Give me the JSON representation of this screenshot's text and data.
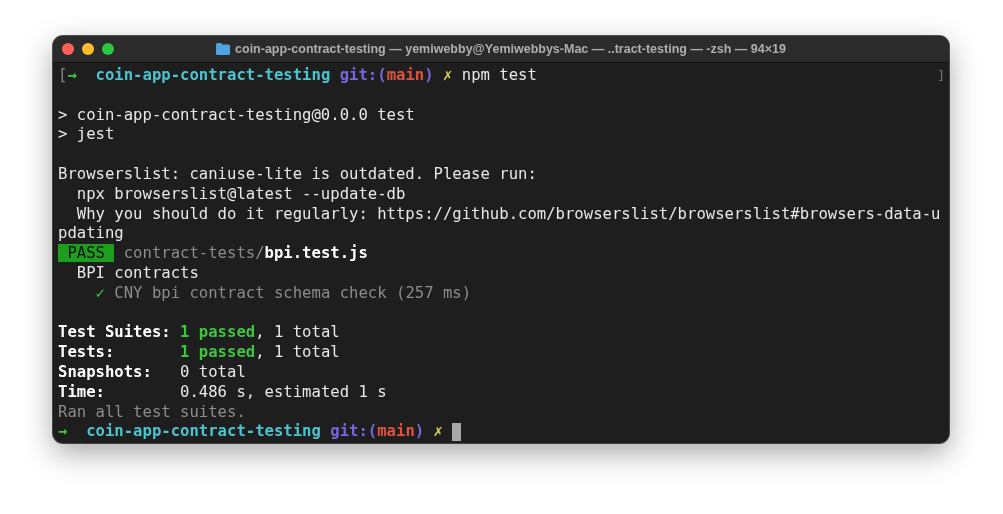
{
  "window": {
    "title": "coin-app-contract-testing — yemiwebby@Yemiwebbys-Mac — ..tract-testing — -zsh — 94×19"
  },
  "blocks": [
    [
      {
        "segments": [
          {
            "text": "[",
            "kind": "mark"
          },
          {
            "text": "→  ",
            "kind": "arrow"
          },
          {
            "text": "coin-app-contract-testing ",
            "kind": "dir"
          },
          {
            "text": "git:(",
            "kind": "git"
          },
          {
            "text": "main",
            "kind": "branch"
          },
          {
            "text": ") ",
            "kind": "git"
          },
          {
            "text": "✗ ",
            "kind": "dirty"
          },
          {
            "text": "npm test",
            "kind": "plain"
          }
        ],
        "right_mark": "]"
      }
    ],
    [
      {
        "segments": [
          {
            "text": "> coin-app-contract-testing@0.0.0 test",
            "kind": "plain"
          }
        ]
      },
      {
        "segments": [
          {
            "text": "> jest",
            "kind": "plain"
          }
        ]
      }
    ],
    [
      {
        "segments": [
          {
            "text": "Browserslist: caniuse-lite is outdated. Please run:",
            "kind": "plain"
          }
        ]
      },
      {
        "segments": [
          {
            "text": "  npx browserslist@latest --update-db",
            "kind": "plain"
          }
        ]
      },
      {
        "segments": [
          {
            "text": "  Why you should do it regularly: https://github.com/browserslist/browserslist#browsers-data-u",
            "kind": "plain"
          }
        ]
      },
      {
        "segments": [
          {
            "text": "pdating",
            "kind": "plain"
          }
        ]
      },
      {
        "segments": [
          {
            "text": " PASS ",
            "kind": "badge"
          },
          {
            "text": " contract-tests/",
            "kind": "dim"
          },
          {
            "text": "bpi.test.js",
            "kind": "bold"
          }
        ]
      },
      {
        "segments": [
          {
            "text": "  BPI contracts",
            "kind": "plain"
          }
        ]
      },
      {
        "segments": [
          {
            "text": "    ✓",
            "kind": "check"
          },
          {
            "text": " CNY bpi contract schema check (257 ms)",
            "kind": "dim"
          }
        ]
      }
    ],
    [
      {
        "segments": [
          {
            "text": "Test Suites: ",
            "kind": "bold"
          },
          {
            "text": "1 passed",
            "kind": "pass"
          },
          {
            "text": ", 1 total",
            "kind": "plain"
          }
        ]
      },
      {
        "segments": [
          {
            "text": "Tests:       ",
            "kind": "bold"
          },
          {
            "text": "1 passed",
            "kind": "pass"
          },
          {
            "text": ", 1 total",
            "kind": "plain"
          }
        ]
      },
      {
        "segments": [
          {
            "text": "Snapshots:   ",
            "kind": "bold"
          },
          {
            "text": "0 total",
            "kind": "plain"
          }
        ]
      },
      {
        "segments": [
          {
            "text": "Time:        ",
            "kind": "bold"
          },
          {
            "text": "0.486 s, estimated 1 s",
            "kind": "plain"
          }
        ]
      },
      {
        "segments": [
          {
            "text": "Ran all test suites.",
            "kind": "dim"
          }
        ]
      },
      {
        "segments": [
          {
            "text": "→  ",
            "kind": "arrow"
          },
          {
            "text": "coin-app-contract-testing ",
            "kind": "dir"
          },
          {
            "text": "git:(",
            "kind": "git"
          },
          {
            "text": "main",
            "kind": "branch"
          },
          {
            "text": ") ",
            "kind": "git"
          },
          {
            "text": "✗ ",
            "kind": "dirty"
          }
        ],
        "cursor": true
      }
    ]
  ]
}
